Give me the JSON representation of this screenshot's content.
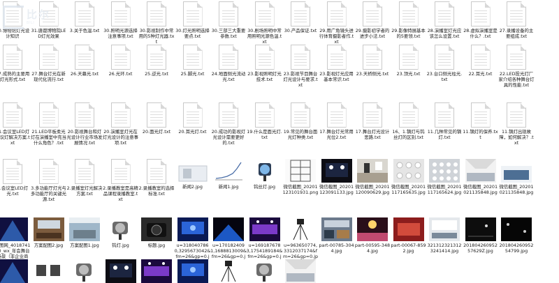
{
  "watermark": {
    "name": "比尔",
    "sub": "BILI"
  },
  "items": [
    {
      "label": "30.博物馆灯光设计知识",
      "kind": "file",
      "page_label_visible": false
    },
    {
      "label": "31.唐都博物院LED灯光效果",
      "kind": "file"
    },
    {
      "label": "3.关于色温.txt",
      "kind": "file"
    },
    {
      "label": "30.照明光源选择注意事项.txt",
      "kind": "file"
    },
    {
      "label": "30.影视制作中常用的5种灯光器.txt",
      "kind": "file"
    },
    {
      "label": "30.灯光照明选择要点.txt",
      "kind": "file"
    },
    {
      "label": "30.三部三大重要参数.txt",
      "kind": "file"
    },
    {
      "label": "30.剧场照明中常用照明光源色温.txt",
      "kind": "file"
    },
    {
      "label": "30.产品保证.txt",
      "kind": "file"
    },
    {
      "label": "29.用广角镜头进行体育摄影者作.txt",
      "kind": "file"
    },
    {
      "label": "29.摄影初学者的进步小法.txt",
      "kind": "file"
    },
    {
      "label": "29.影像特展基本的5要领.txt",
      "kind": "file"
    },
    {
      "label": "28.演播室灯光应该怎么设置.txt",
      "kind": "file"
    },
    {
      "label": "28.虚拟演播室是什么？.txt",
      "kind": "file"
    },
    {
      "label": "27.录播设备的主要组成.txt",
      "kind": "file"
    },
    {
      "label": "27.温光.txt",
      "kind": "file"
    },
    {
      "label": "27.夏用光讲究灯光布置技巧.txt",
      "kind": "file"
    },
    {
      "label": "27.成熟的主要用灯光形式.txt",
      "kind": "file"
    },
    {
      "label": "27.舞台灯光在新现代化流行.txt",
      "kind": "file"
    },
    {
      "label": "26.天幕光.txt",
      "kind": "file"
    },
    {
      "label": "26.光环.txt",
      "kind": "file"
    },
    {
      "label": "25.逆光.txt",
      "kind": "file"
    },
    {
      "label": "25.脚光.txt",
      "kind": "file"
    },
    {
      "label": "24.地面侧光流动光.txt",
      "kind": "file"
    },
    {
      "label": "23.影视照明灯光技术.txt",
      "kind": "file"
    },
    {
      "label": "23.影视节目舞台灯光设计与要求.txt",
      "kind": "file"
    },
    {
      "label": "23.影视灯光应用基本常识.txt",
      "kind": "file"
    },
    {
      "label": "23.天桥侧光.txt",
      "kind": "file"
    },
    {
      "label": "23.顶光.txt",
      "kind": "file"
    },
    {
      "label": "23.台口侧光柱光.txt",
      "kind": "file"
    },
    {
      "label": "22.耳光.txt",
      "kind": "file"
    },
    {
      "label": "22.LED投光灯厂家介绍各种舞台灯具的性能.txt",
      "kind": "file"
    },
    {
      "label": "22.led灯原理.txt",
      "kind": "file"
    },
    {
      "label": "22.面光，面到专业灯光师，最前排面光.txt",
      "kind": "file"
    },
    {
      "label": "21.会议室LED灯会议灯解决方案.txt",
      "kind": "file"
    },
    {
      "label": "21.LED平板柔光灯在演播室中充当什么角色？.txt",
      "kind": "file"
    },
    {
      "label": "20.影视舞台和灯光设计行业市场发展情况.txt",
      "kind": "file"
    },
    {
      "label": "20.演播室灯光在灯光设计的注意事项.txt",
      "kind": "file"
    },
    {
      "label": "20.面光灯.txt",
      "kind": "file"
    },
    {
      "label": "20.耳光灯.txt",
      "kind": "file"
    },
    {
      "label": "20.成功的影视灯光设计需要更好的.txt",
      "kind": "file"
    },
    {
      "label": "19.什么是面光灯.txt",
      "kind": "file"
    },
    {
      "label": "19.常见的舞台面光灯种类.txt",
      "kind": "file"
    },
    {
      "label": "17.舞台灯光常用光位2.txt",
      "kind": "file"
    },
    {
      "label": "17.舞台灯光设计思路.txt",
      "kind": "file"
    },
    {
      "label": "16、1.镝灯与钨丝灯的区别.txt",
      "kind": "file"
    },
    {
      "label": "11.几种常见的镝灯.txt",
      "kind": "file"
    },
    {
      "label": "11.镝灯的保养.txt",
      "kind": "file"
    },
    {
      "label": "11.镝灯出现故障，如何解决？.txt",
      "kind": "file"
    },
    {
      "label": "3.演播室灯光解决方案.txt",
      "kind": "file"
    },
    {
      "label": "3.会议室LED灯光.txt",
      "kind": "file"
    },
    {
      "label": "3.多功能厅灯光与多功能厅的关键光源.txt",
      "kind": "file"
    },
    {
      "label": "2.录播室灯光解决方案.txt",
      "kind": "file"
    },
    {
      "label": "2.录播教室是高精品课程录播教室.txt",
      "kind": "file"
    },
    {
      "label": "2.录播教室的选择标准.txt",
      "kind": "file"
    },
    {
      "label": "新闻2.jpg",
      "kind": "img",
      "img": "screen"
    },
    {
      "label": "新闻1.jpg",
      "kind": "img",
      "img": "chart"
    },
    {
      "label": "钨丝灯.jpg",
      "kind": "img",
      "img": "spot"
    },
    {
      "label": "微信截图_20201123101931.png",
      "kind": "img",
      "img": "rig"
    },
    {
      "label": "微信截图_20201123091133.jpg",
      "kind": "img",
      "img": "stage"
    },
    {
      "label": "微信截图_20201120090629.jpg",
      "kind": "img",
      "img": "studio"
    },
    {
      "label": "微信截图_20201117165635.jpg",
      "kind": "img",
      "img": "panel"
    },
    {
      "label": "微信截图_20201117165624.jpg",
      "kind": "img",
      "img": "grid"
    },
    {
      "label": "微信截图_20201021135848.jpg",
      "kind": "img",
      "img": "hall"
    },
    {
      "label": "微信截图_20201021135848.jpg",
      "kind": "img",
      "img": "hall2"
    },
    {
      "label": "摄图网_500654192_wx_游艺厅灯光系统（非企业商用）.jpg",
      "kind": "img",
      "img": "club"
    },
    {
      "label": "摄图网_401874180_wx_年会舞台场景（非企业商用）.jpg",
      "kind": "img",
      "img": "club2"
    },
    {
      "label": "方案配图2.jpg",
      "kind": "img",
      "img": "conf"
    },
    {
      "label": "方案配图1.jpg",
      "kind": "img",
      "img": "room"
    },
    {
      "label": "钨灯.jpg",
      "kind": "img",
      "img": "fresnel"
    },
    {
      "label": "标题.jpg",
      "kind": "img",
      "img": "camera"
    },
    {
      "label": "u=3180407860,3295673042&fm=26&gp=0.jpg",
      "kind": "img",
      "img": "blue"
    },
    {
      "label": "u=1701824091,1688813009&fm=26&gp=0.jpg",
      "kind": "img",
      "img": "stage2"
    },
    {
      "label": "u=1691876783,1754189184&fm=26&gp=0.jpg",
      "kind": "img",
      "img": "purple"
    },
    {
      "label": "u=963650774,3312037174&fm=26&gp=0.jpg",
      "kind": "img",
      "img": "tripod"
    },
    {
      "label": "part-00785-3044.jpg",
      "kind": "img",
      "img": "busy"
    },
    {
      "label": "part-00595-3484.jpg",
      "kind": "img",
      "img": "concert"
    },
    {
      "label": "part-00067-8592.jpg",
      "kind": "img",
      "img": "red"
    },
    {
      "label": "3213123213123241414.jpg",
      "kind": "img",
      "img": "office"
    },
    {
      "label": "20180426095257629Z.jpg",
      "kind": "img",
      "img": "dark"
    },
    {
      "label": "20180426095254799.jpg",
      "kind": "img",
      "img": "dark2"
    },
    {
      "label": "",
      "kind": "img",
      "img": "club"
    },
    {
      "label": "",
      "kind": "img",
      "img": "club2"
    },
    {
      "label": "",
      "kind": "img",
      "img": "lamps"
    },
    {
      "label": "",
      "kind": "img",
      "img": "fresnel"
    },
    {
      "label": "",
      "kind": "img",
      "img": "stage"
    },
    {
      "label": "",
      "kind": "img",
      "img": "purple"
    },
    {
      "label": "",
      "kind": "img",
      "img": "blue"
    },
    {
      "label": "",
      "kind": "img",
      "img": "tripod"
    },
    {
      "label": "",
      "kind": "img",
      "img": "fresnel"
    },
    {
      "label": "",
      "kind": "img",
      "img": "hall"
    }
  ]
}
